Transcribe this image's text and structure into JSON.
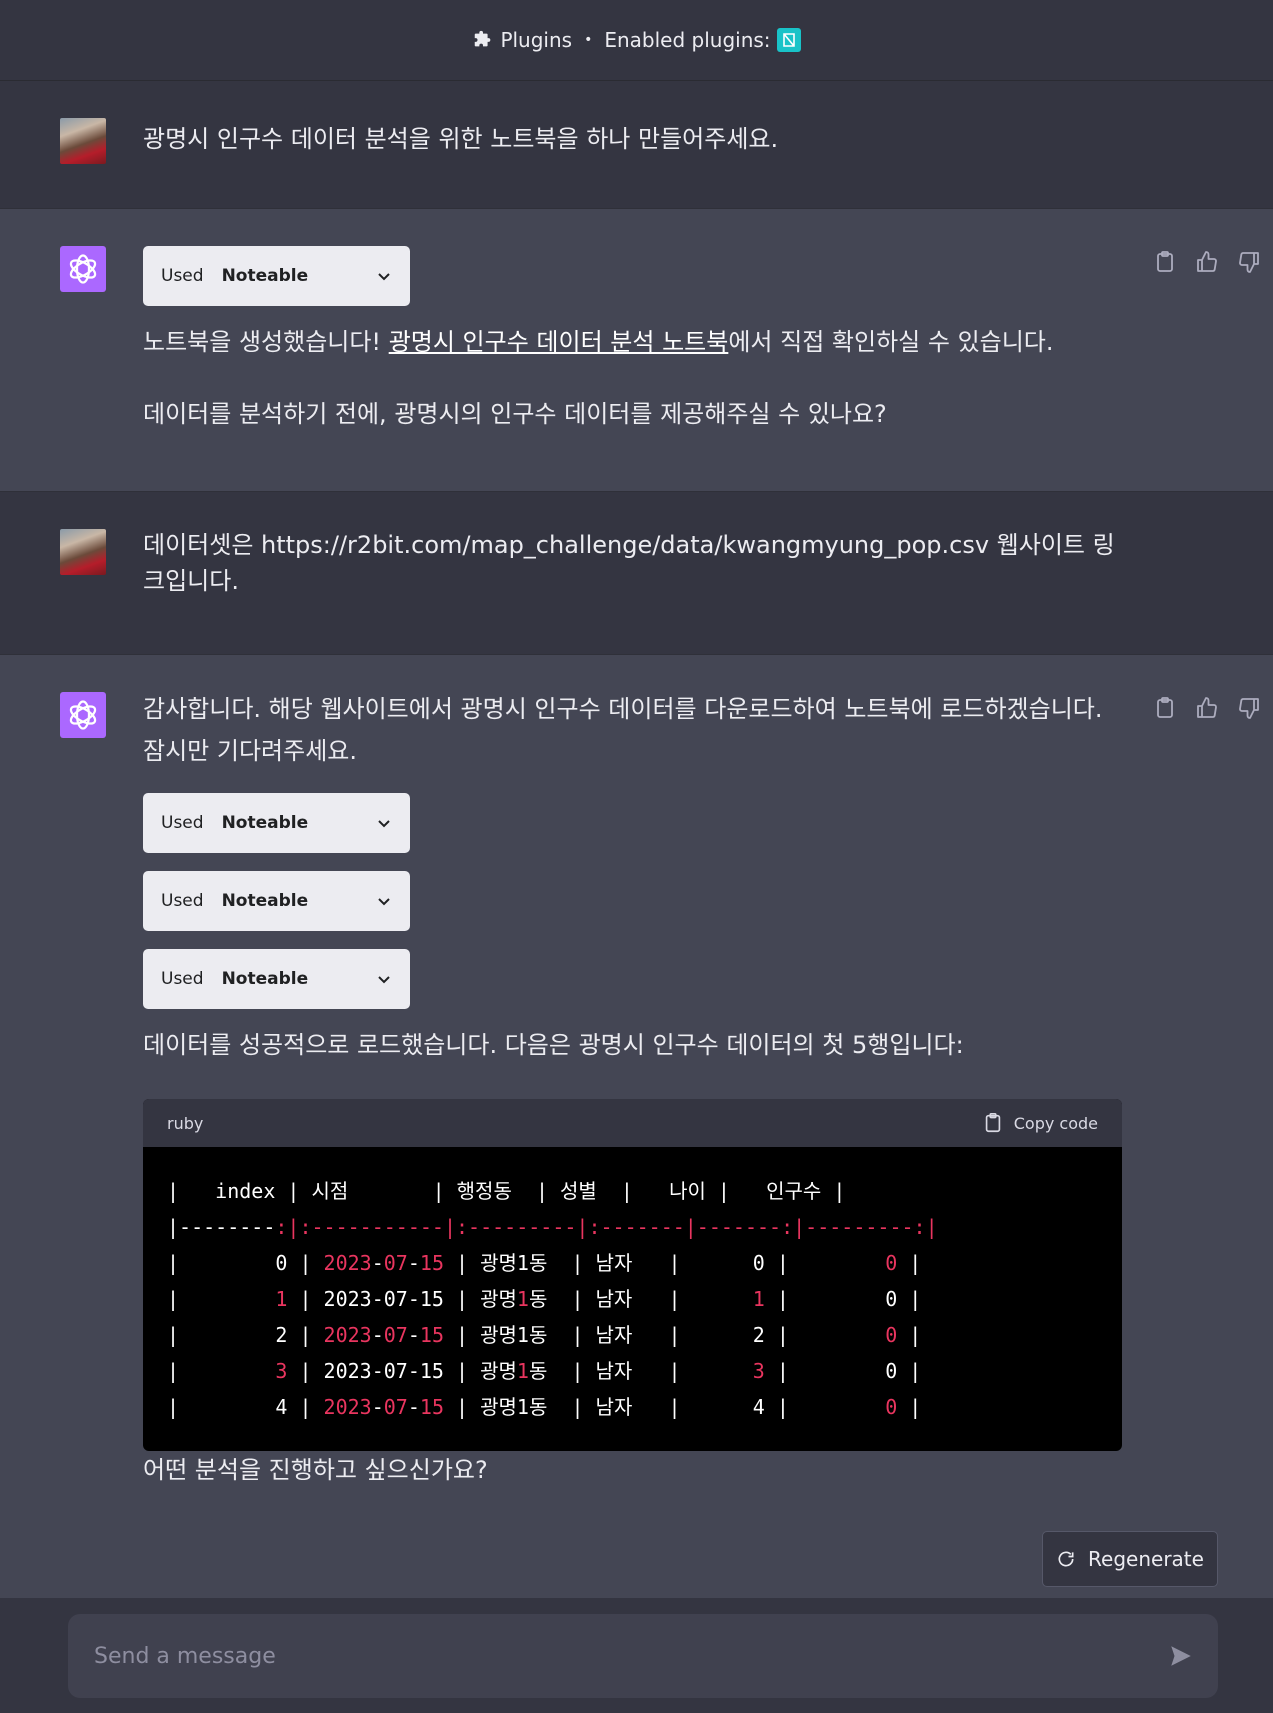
{
  "header": {
    "plugins_label": "Plugins",
    "separator": "•",
    "enabled_label": "Enabled plugins:",
    "plugin_icon": "noteable-icon",
    "plugin_color": "#19c3c8"
  },
  "messages": {
    "user1": {
      "text": "광명시 인구수 데이터 분석을 위한 노트북을 하나 만들어주세요."
    },
    "bot1": {
      "used_label": "Used",
      "plugin_name": "Noteable",
      "line1_before": "노트북을 생성했습니다! ",
      "line1_link": "광명시 인구수 데이터 분석 노트북",
      "line1_after": "에서 직접 확인하실 수 있습니다.",
      "line2": "데이터를 분석하기 전에, 광명시의 인구수 데이터를 제공해주실 수 있나요?"
    },
    "user2": {
      "text": "데이터셋은 https://r2bit.com/map_challenge/data/kwangmyung_pop.csv 웹사이트 링크입니다."
    },
    "bot2": {
      "intro": "감사합니다. 해당 웹사이트에서 광명시 인구수 데이터를 다운로드하여 노트북에 로드하겠습니다. 잠시만 기다려주세요.",
      "used_label": "Used",
      "plugin_name": "Noteable",
      "loaded": "데이터를 성공적으로 로드했습니다. 다음은 광명시 인구수 데이터의 첫 5행입니다:",
      "code_lang": "ruby",
      "copy_label": "Copy code",
      "table_header": [
        "index",
        "시점",
        "행정동",
        "성별",
        "나이",
        "인구수"
      ],
      "rows": [
        [
          "0",
          "2023-07-15",
          "광명1동",
          "남자",
          "0",
          "0"
        ],
        [
          "1",
          "2023-07-15",
          "광명1동",
          "남자",
          "1",
          "0"
        ],
        [
          "2",
          "2023-07-15",
          "광명1동",
          "남자",
          "2",
          "0"
        ],
        [
          "3",
          "2023-07-15",
          "광명1동",
          "남자",
          "3",
          "0"
        ],
        [
          "4",
          "2023-07-15",
          "광명1동",
          "남자",
          "4",
          "0"
        ]
      ],
      "question": "어떤 분석을 진행하고 싶으신가요?"
    }
  },
  "regenerate_label": "Regenerate",
  "composer": {
    "placeholder": "Send a message"
  },
  "colors": {
    "accent_red": "#e9355f",
    "bot_avatar": "#ab68ff"
  }
}
